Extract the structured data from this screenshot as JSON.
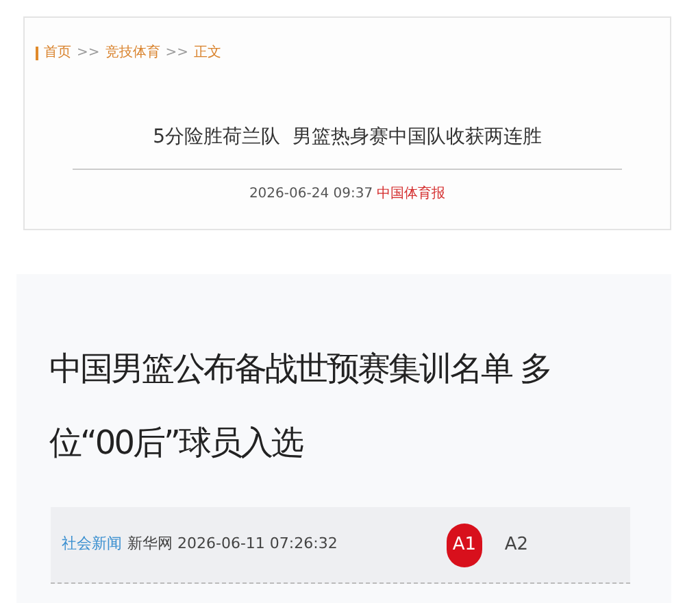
{
  "article_1": {
    "breadcrumb": [
      {
        "label": "首页"
      },
      {
        "label": "竞技体育"
      },
      {
        "label": "正文"
      }
    ],
    "breadcrumb_separator": ">>",
    "title": "5分险胜荷兰队  男篮热身赛中国队收获两连胜",
    "date": "2026-06-24 09:37",
    "source": "中国体育报"
  },
  "article_2": {
    "title": "中国男篮公布备战世预赛集训名单 多位“00后”球员入选",
    "category": "社会新闻",
    "source": "新华网",
    "date": "2026-06-11 07:26:32",
    "font_sizes": [
      {
        "label": "A1",
        "selected": true
      },
      {
        "label": "A2",
        "selected": false
      }
    ]
  }
}
